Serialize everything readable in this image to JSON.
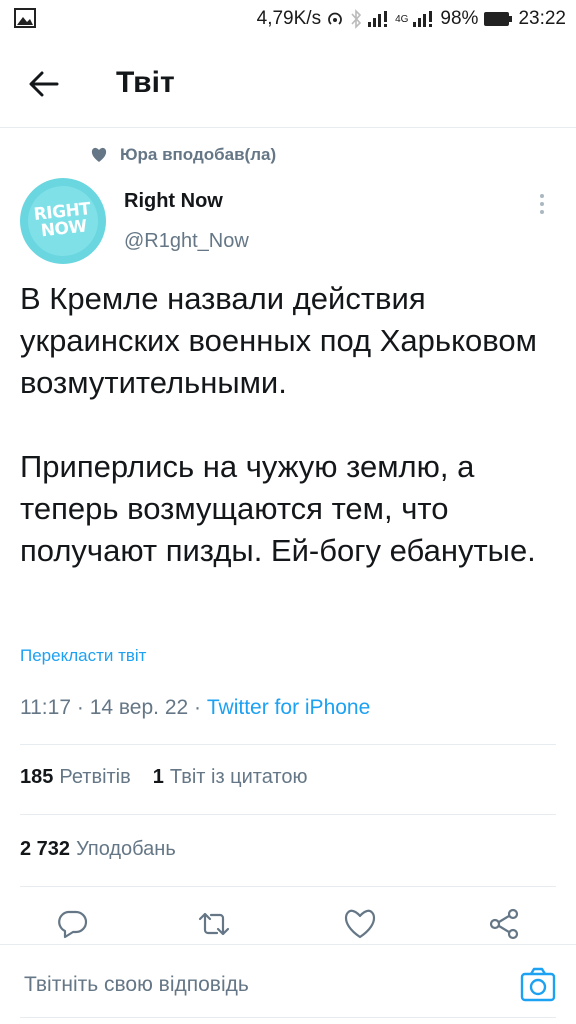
{
  "status_bar": {
    "network_speed": "4,79K/s",
    "network_type": "4G",
    "battery": "98%",
    "time": "23:22"
  },
  "header": {
    "title": "Твіт",
    "back_icon": "arrow-left-icon"
  },
  "social_context": {
    "text": "Юра вподобав(ла)",
    "icon": "heart-icon"
  },
  "author": {
    "name": "Right Now",
    "handle": "@R1ght_Now",
    "avatar_text": [
      "RIGHT",
      "NOW"
    ]
  },
  "tweet": {
    "text": "В Кремле назвали действия украинских военных под Харьковом возмутительными.\n\nПриперлись на чужую землю, а теперь возмущаются тем, что получают пизды. Ей-богу ебанутые.",
    "translate_label": "Перекласти твіт",
    "time": "11:17",
    "date": "14 вер. 22",
    "source": "Twitter for iPhone",
    "sep": "·"
  },
  "stats": {
    "retweets_count": "185",
    "retweets_label": "Ретвітів",
    "quotes_count": "1",
    "quotes_label": "Твіт із цитатою",
    "likes_count": "2 732",
    "likes_label": "Уподобань"
  },
  "reply": {
    "placeholder": "Твітніть свою відповідь"
  },
  "colors": {
    "accent": "#1da1f2",
    "secondary_text": "#657786",
    "divider": "#e6ecf0",
    "avatar_bg": "#6ad6df"
  }
}
